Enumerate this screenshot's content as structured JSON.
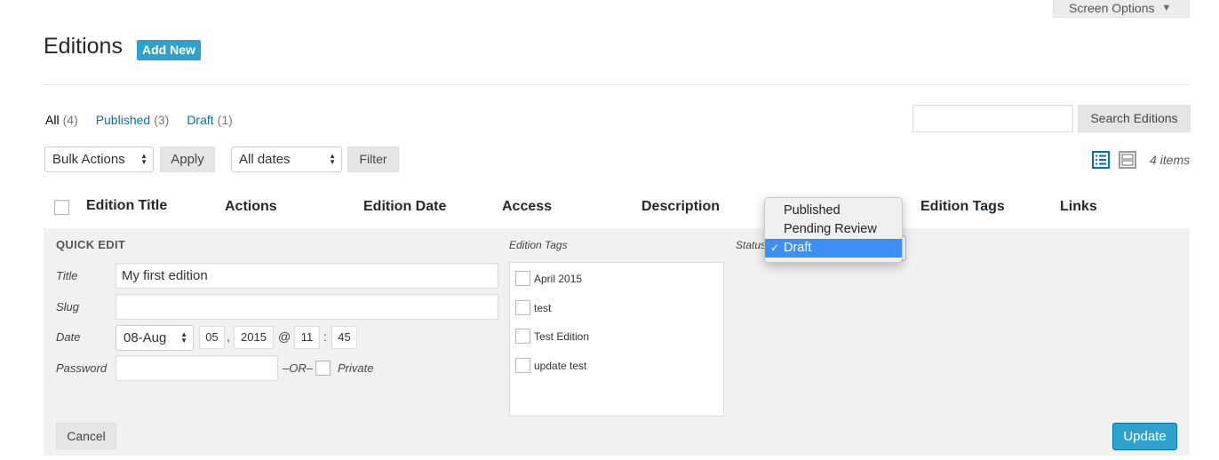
{
  "screen_options": {
    "label": "Screen Options"
  },
  "header": {
    "title": "Editions",
    "add_new_label": "Add New"
  },
  "views": [
    {
      "label": "All",
      "count": "(4)",
      "current": true
    },
    {
      "label": "Published",
      "count": "(3)",
      "current": false
    },
    {
      "label": "Draft",
      "count": "(1)",
      "current": false
    }
  ],
  "search": {
    "value": "",
    "button_label": "Search Editions"
  },
  "tablenav": {
    "bulk_actions": "Bulk Actions",
    "apply_label": "Apply",
    "dates_filter": "All dates",
    "filter_label": "Filter",
    "items_count": "4 items"
  },
  "columns": [
    "Edition Title",
    "Actions",
    "Edition Date",
    "Access",
    "Description",
    "Edition Tags",
    "Links"
  ],
  "quick_edit": {
    "heading": "QUICK EDIT",
    "title_label": "Title",
    "title_value": "My first edition",
    "slug_label": "Slug",
    "slug_value": "",
    "date_label": "Date",
    "date": {
      "month": "08-Aug",
      "day": "05",
      "year": "2015",
      "hour": "11",
      "minute": "45",
      "comma": ",",
      "at": "@",
      "colon": ":"
    },
    "password_label": "Password",
    "password_value": "",
    "or_label": "–OR–",
    "private_label": "Private",
    "tags_label": "Edition Tags",
    "tags": [
      "April 2015",
      "test",
      "Test Edition",
      "update test"
    ],
    "status_label": "Status",
    "status_options": [
      "Published",
      "Pending Review",
      "Draft"
    ],
    "status_selected": "Draft",
    "cancel_label": "Cancel",
    "update_label": "Update"
  },
  "colors": {
    "accent": "#2ea2cc",
    "link": "#0073aa",
    "panel_bg": "#f1f1f1",
    "dropdown_highlight": "#3d8ff3"
  }
}
